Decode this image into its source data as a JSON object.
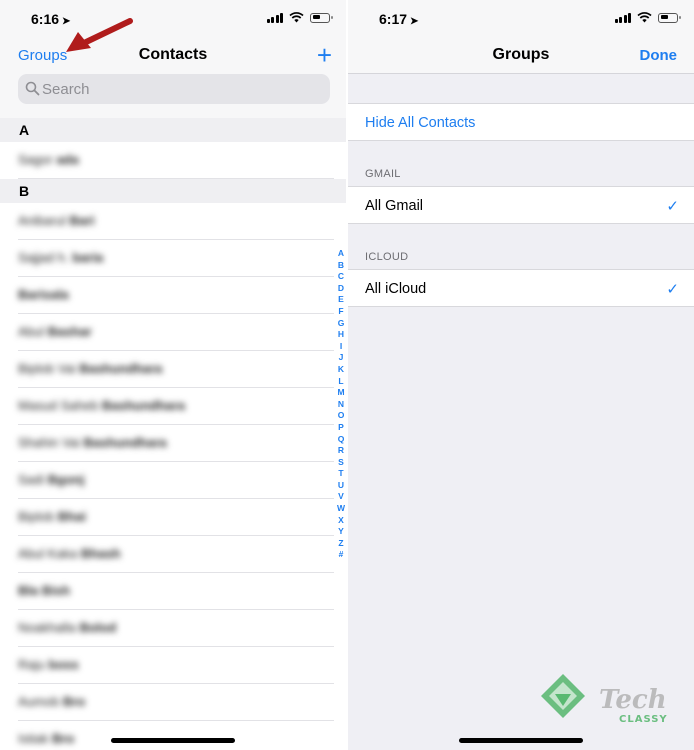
{
  "left": {
    "status": {
      "time": "6:16",
      "location_glyph": "➤"
    },
    "nav": {
      "left_label": "Groups",
      "title": "Contacts",
      "add_glyph": "+"
    },
    "search": {
      "placeholder": "Search"
    },
    "sections": [
      {
        "header": "A",
        "contacts": [
          {
            "first": "Sagor",
            "last": "ada"
          }
        ]
      },
      {
        "header": "B",
        "contacts": [
          {
            "first": "Anibarul",
            "last": "Bari"
          },
          {
            "first": "Sajjad h.",
            "last": "baria"
          },
          {
            "first": "",
            "last": "Barisala"
          },
          {
            "first": "Abul",
            "last": "Bashar"
          },
          {
            "first": "Biplob Vai",
            "last": "Bashundhara"
          },
          {
            "first": "Masud Saheb",
            "last": "Bashundhara"
          },
          {
            "first": "Shahin Vai",
            "last": "Bashundhara"
          },
          {
            "first": "Sadi",
            "last": "Bgonj"
          },
          {
            "first": "Biplob",
            "last": "Bhai"
          },
          {
            "first": "Abul Kaka",
            "last": "Bhash"
          },
          {
            "first": "",
            "last": "Bla Bish"
          },
          {
            "first": "Noakhalla",
            "last": "Bolod"
          },
          {
            "first": "Raju",
            "last": "boss"
          },
          {
            "first": "Aumob",
            "last": "Bro"
          },
          {
            "first": "Istiak",
            "last": "Bro"
          }
        ]
      }
    ],
    "index_letters": [
      "A",
      "B",
      "C",
      "D",
      "E",
      "F",
      "G",
      "H",
      "I",
      "J",
      "K",
      "L",
      "M",
      "N",
      "O",
      "P",
      "Q",
      "R",
      "S",
      "T",
      "U",
      "V",
      "W",
      "X",
      "Y",
      "Z",
      "#"
    ]
  },
  "right": {
    "status": {
      "time": "6:17",
      "location_glyph": "➤"
    },
    "nav": {
      "title": "Groups",
      "done_label": "Done"
    },
    "hide_all_label": "Hide All Contacts",
    "gmail": {
      "caption": "GMAIL",
      "item_label": "All Gmail",
      "checked": true
    },
    "icloud": {
      "caption": "ICLOUD",
      "item_label": "All iCloud",
      "checked": true
    },
    "check_glyph": "✓"
  },
  "watermark": {
    "top": "Tech",
    "bottom": "CLASSY"
  },
  "colors": {
    "ios_blue": "#1e7ef0",
    "annotation_arrow": "#b01c1c",
    "watermark_green": "#3fae5a"
  }
}
